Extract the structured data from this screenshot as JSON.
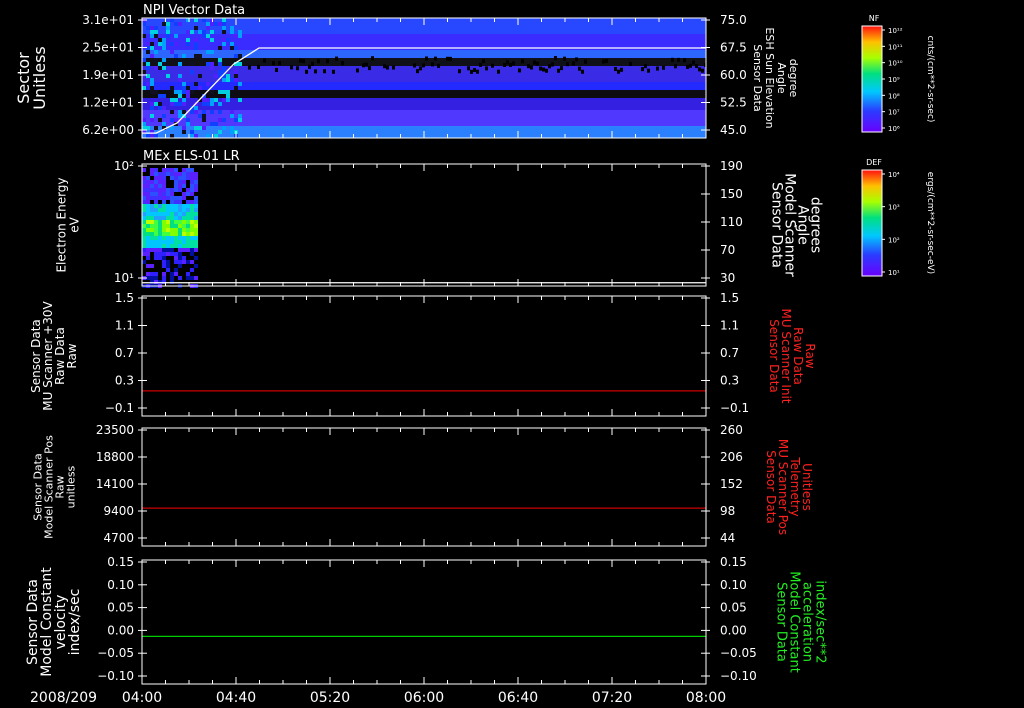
{
  "chart_data": [
    {
      "type": "heatmap",
      "title": "NPI Vector Data",
      "ylabel": [
        "Sector",
        "Unitless"
      ],
      "yticks": [
        "3.1e+01",
        "2.5e+01",
        "1.9e+01",
        "1.2e+01",
        "6.2e+00"
      ],
      "ylim": [
        0,
        31
      ],
      "y2label": [
        "Sensor Data",
        "ESH Sun Elevation",
        "Angle",
        "degree"
      ],
      "y2ticks": [
        "75.0",
        "67.5",
        "60.0",
        "52.5",
        "45.0"
      ],
      "y2lim": [
        37.5,
        75
      ],
      "overlay_line": {
        "color": "#ffffff",
        "points": [
          [
            0,
            38.5
          ],
          [
            0.1,
            38.5
          ],
          [
            0.25,
            42
          ],
          [
            0.45,
            52
          ],
          [
            0.65,
            62
          ],
          [
            0.83,
            67.5
          ],
          [
            4.0,
            67.5
          ]
        ]
      },
      "colorbar": {
        "label": "NF",
        "units": "cnts/(cm**2-sr-sec)",
        "ticks": [
          "10¹²",
          "10¹¹",
          "10¹⁰",
          "10⁹",
          "10⁸",
          "10⁷",
          "10⁶"
        ]
      }
    },
    {
      "type": "heatmap",
      "title": "MEx ELS-01 LR",
      "ylabel": [
        "Electron Energy",
        "eV"
      ],
      "yticks": [
        "10²",
        "10¹"
      ],
      "y2label": [
        "Sensor Data",
        "Model Scanner",
        "Angle",
        "degrees"
      ],
      "y2ticks": [
        "190",
        "150",
        "110",
        "70",
        "30"
      ],
      "y2lim": [
        10,
        190
      ],
      "data_extent_hours": [
        0,
        0.37
      ],
      "overlay_line": {
        "color": "#ffffff",
        "value": 12
      },
      "colorbar": {
        "label": "DEF",
        "units": "ergs/(cm**2-sr-sec-eV)",
        "ticks": [
          "10⁴",
          "10³",
          "10²",
          "10¹"
        ]
      }
    },
    {
      "type": "line",
      "ylabel": [
        "Sensor Data",
        "MU Scanner +30V",
        "Raw Data",
        "Raw"
      ],
      "yticks": [
        "1.5",
        "1.1",
        "0.7",
        "0.3",
        "−0.1"
      ],
      "ylim": [
        -0.4,
        1.5
      ],
      "y2label": [
        "Sensor Data",
        "MU Scanner Init",
        "Raw Data",
        "Raw"
      ],
      "y2ticks": [
        "1.5",
        "1.1",
        "0.7",
        "0.3",
        "−0.1"
      ],
      "series": [
        {
          "color": "#cc0000",
          "constant": 0.0
        }
      ],
      "y2label_color": "#ff2020"
    },
    {
      "type": "line",
      "ylabel": [
        "Sensor Data",
        "Model Scanner Pos",
        "Raw",
        "unitless"
      ],
      "yticks": [
        "23500",
        "18800",
        "14100",
        "9400",
        "4700"
      ],
      "ylim": [
        0,
        23500
      ],
      "y2label": [
        "Sensor Data",
        "MU Scanner Pos",
        "Telemetry",
        "Unitless"
      ],
      "y2ticks": [
        "260",
        "206",
        "152",
        "98",
        "44"
      ],
      "series": [
        {
          "color": "#cc0000",
          "constant": 7800
        }
      ],
      "y2label_color": "#ff2020"
    },
    {
      "type": "line",
      "ylabel": [
        "Sensor Data",
        "Model Constant",
        "velocity",
        "index/sec"
      ],
      "yticks": [
        "0.15",
        "0.10",
        "0.05",
        "0.00",
        "−0.05",
        "−0.10"
      ],
      "ylim": [
        -0.1,
        0.15
      ],
      "y2label": [
        "Sensor Data",
        "Model Constant",
        "acceleration",
        "index/sec**2"
      ],
      "y2ticks": [
        "0.15",
        "0.10",
        "0.05",
        "0.00",
        "−0.05",
        "−0.10"
      ],
      "series": [
        {
          "color": "#00cc00",
          "constant": 0.0
        }
      ],
      "y2label_color": "#22ee22"
    }
  ],
  "x_axis": {
    "date": "2008/209",
    "ticks": [
      "04:00",
      "04:40",
      "05:20",
      "06:00",
      "06:40",
      "07:20",
      "08:00"
    ],
    "range_hours": [
      0,
      4
    ]
  },
  "colors": {
    "background": "#000000",
    "axis": "#ffffff"
  }
}
